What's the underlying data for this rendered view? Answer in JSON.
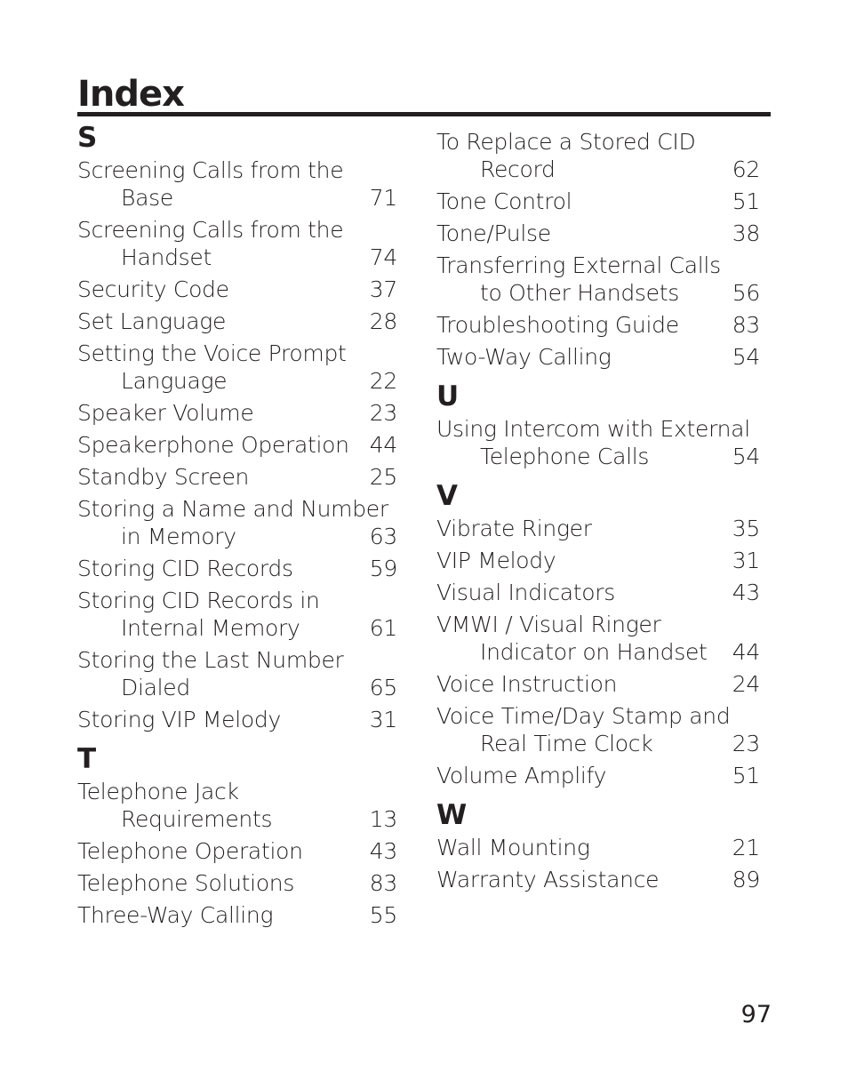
{
  "page_title": "Index",
  "page_number": "97",
  "columns": [
    {
      "sections": [
        {
          "letter": "S",
          "entries": [
            {
              "line1": "Screening Calls from the",
              "line2": "Base",
              "page": "71"
            },
            {
              "line1": "Screening Calls from the",
              "line2": "Handset",
              "page": "74"
            },
            {
              "line1": "Security Code",
              "line2": "",
              "page": "37"
            },
            {
              "line1": "Set Language",
              "line2": "",
              "page": "28"
            },
            {
              "line1": "Setting the Voice Prompt",
              "line2": "Language",
              "page": "22"
            },
            {
              "line1": "Speaker Volume",
              "line2": "",
              "page": "23"
            },
            {
              "line1": "Speakerphone Operation",
              "line2": "",
              "page": "44"
            },
            {
              "line1": "Standby Screen",
              "line2": "",
              "page": "25"
            },
            {
              "line1": "Storing a Name and Number",
              "line2": "in Memory",
              "page": "63"
            },
            {
              "line1": "Storing CID Records",
              "line2": "",
              "page": "59"
            },
            {
              "line1": "Storing CID Records in",
              "line2": "Internal Memory",
              "page": "61"
            },
            {
              "line1": "Storing the Last Number",
              "line2": "Dialed",
              "page": "65"
            },
            {
              "line1": "Storing VIP Melody",
              "line2": "",
              "page": "31"
            }
          ]
        },
        {
          "letter": "T",
          "entries": [
            {
              "line1": "Telephone Jack",
              "line2": "Requirements",
              "page": "13"
            },
            {
              "line1": "Telephone Operation",
              "line2": "",
              "page": "43"
            },
            {
              "line1": "Telephone Solutions",
              "line2": "",
              "page": "83"
            },
            {
              "line1": "Three-Way Calling",
              "line2": "",
              "page": "55"
            }
          ]
        }
      ]
    },
    {
      "sections": [
        {
          "letter": "",
          "entries": [
            {
              "line1": "To Replace a Stored CID",
              "line2": "Record",
              "page": "62"
            },
            {
              "line1": "Tone Control",
              "line2": "",
              "page": "51"
            },
            {
              "line1": "Tone/Pulse",
              "line2": "",
              "page": "38"
            },
            {
              "line1": "Transferring External Calls",
              "line2": "to Other Handsets",
              "page": "56"
            },
            {
              "line1": "Troubleshooting Guide",
              "line2": "",
              "page": "83"
            },
            {
              "line1": "Two-Way Calling",
              "line2": "",
              "page": "54"
            }
          ]
        },
        {
          "letter": "U",
          "entries": [
            {
              "line1": "Using Intercom with External",
              "line2": "Telephone Calls",
              "page": "54"
            }
          ]
        },
        {
          "letter": "V",
          "entries": [
            {
              "line1": "Vibrate Ringer",
              "line2": "",
              "page": "35"
            },
            {
              "line1": "VIP Melody",
              "line2": "",
              "page": "31"
            },
            {
              "line1": "Visual Indicators",
              "line2": "",
              "page": "43"
            },
            {
              "line1": "VMWI / Visual Ringer",
              "line2": "Indicator on Handset",
              "page": "44"
            },
            {
              "line1": "Voice Instruction",
              "line2": "",
              "page": "24"
            },
            {
              "line1": "Voice Time/Day Stamp and",
              "line2": "Real Time Clock",
              "page": "23"
            },
            {
              "line1": "Volume Amplify",
              "line2": "",
              "page": "51"
            }
          ]
        },
        {
          "letter": "W",
          "entries": [
            {
              "line1": "Wall Mounting",
              "line2": "",
              "page": "21"
            },
            {
              "line1": "Warranty Assistance",
              "line2": "",
              "page": "89"
            }
          ]
        }
      ]
    }
  ]
}
